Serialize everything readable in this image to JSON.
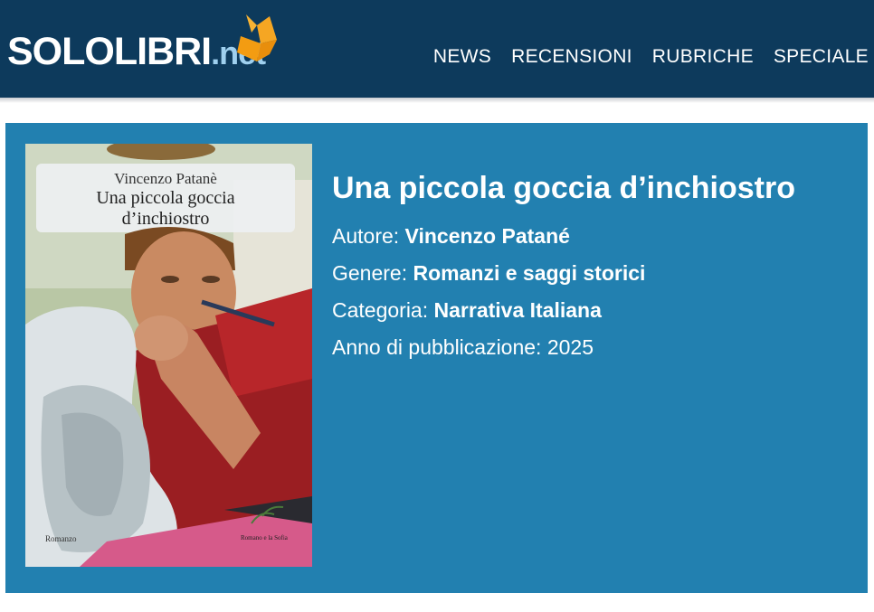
{
  "site": {
    "logo_main": "SOLOLIBRI",
    "logo_suffix": ".net"
  },
  "nav": {
    "items": [
      {
        "label": "NEWS"
      },
      {
        "label": "RECENSIONI"
      },
      {
        "label": "RUBRICHE"
      },
      {
        "label": "SPECIALE"
      }
    ]
  },
  "book": {
    "title": "Una piccola goccia d’inchiostro",
    "cover": {
      "author_line": "Vincenzo Patanè",
      "title_line1": "Una piccola goccia",
      "title_line2": "d’inchiostro",
      "series_label": "Romanzo",
      "publisher_label": "Romano e la Sofia"
    },
    "meta": {
      "author_label": "Autore:",
      "author_value": "Vincenzo Patané",
      "genre_label": "Genere:",
      "genre_value": "Romanzi e saggi storici",
      "category_label": "Categoria:",
      "category_value": "Narrativa Italiana",
      "year_label": "Anno di pubblicazione:",
      "year_value": "2025"
    }
  },
  "colors": {
    "header_bg": "#0d3a5c",
    "card_bg": "#2280b0",
    "logo_accent": "#f5a623",
    "net_text": "#9fd0ef"
  }
}
